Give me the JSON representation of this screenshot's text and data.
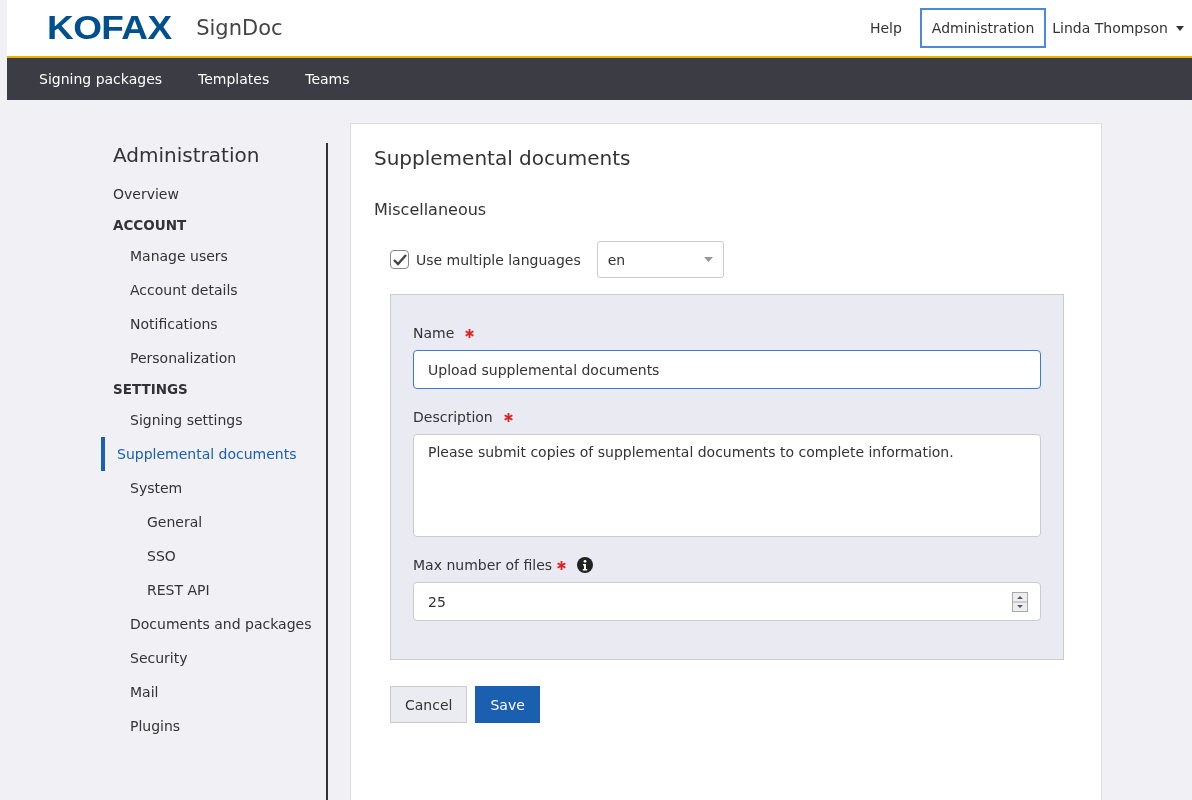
{
  "header": {
    "logo": "KOFAX",
    "product": "SignDoc",
    "links": [
      {
        "label": "Help",
        "selected": false
      },
      {
        "label": "Administration",
        "selected": true
      }
    ],
    "user": "Linda Thompson"
  },
  "nav": [
    {
      "label": "Signing packages"
    },
    {
      "label": "Templates"
    },
    {
      "label": "Teams"
    }
  ],
  "sidebar": {
    "title": "Administration",
    "items": [
      {
        "kind": "link",
        "label": "Overview",
        "selected": false
      },
      {
        "kind": "section",
        "label": "ACCOUNT",
        "children": [
          {
            "kind": "link",
            "label": "Manage users",
            "selected": false
          },
          {
            "kind": "link",
            "label": "Account details",
            "selected": false
          },
          {
            "kind": "link",
            "label": "Notifications",
            "selected": false
          },
          {
            "kind": "link",
            "label": "Personalization",
            "selected": false
          }
        ]
      },
      {
        "kind": "section",
        "label": "SETTINGS",
        "children": [
          {
            "kind": "link",
            "label": "Signing settings",
            "selected": false
          },
          {
            "kind": "link",
            "label": "Supplemental documents",
            "selected": true
          },
          {
            "kind": "link",
            "label": "System",
            "selected": false,
            "children": [
              {
                "kind": "link",
                "label": "General",
                "selected": false
              },
              {
                "kind": "link",
                "label": "SSO",
                "selected": false
              },
              {
                "kind": "link",
                "label": "REST API",
                "selected": false
              }
            ]
          },
          {
            "kind": "link",
            "label": "Documents and packages",
            "selected": false
          },
          {
            "kind": "link",
            "label": "Security",
            "selected": false
          },
          {
            "kind": "link",
            "label": "Mail",
            "selected": false
          },
          {
            "kind": "link",
            "label": "Plugins",
            "selected": false
          }
        ]
      }
    ]
  },
  "main": {
    "title": "Supplemental documents",
    "subtitle": "Miscellaneous",
    "multi_language": {
      "label": "Use multiple languages",
      "checked": true,
      "language": "en"
    },
    "fields": [
      {
        "kind": "text",
        "label": "Name",
        "required": true,
        "value": "Upload supplemental documents",
        "focused": true
      },
      {
        "kind": "textarea",
        "label": "Description",
        "required": true,
        "value": "Please submit copies of supplemental documents to complete information.",
        "focused": false
      },
      {
        "kind": "number",
        "label": "Max number of files",
        "required": true,
        "info": true,
        "value": "25",
        "focused": false
      }
    ],
    "buttons": [
      {
        "label": "Cancel",
        "kind": "secondary"
      },
      {
        "label": "Save",
        "kind": "primary"
      }
    ]
  }
}
